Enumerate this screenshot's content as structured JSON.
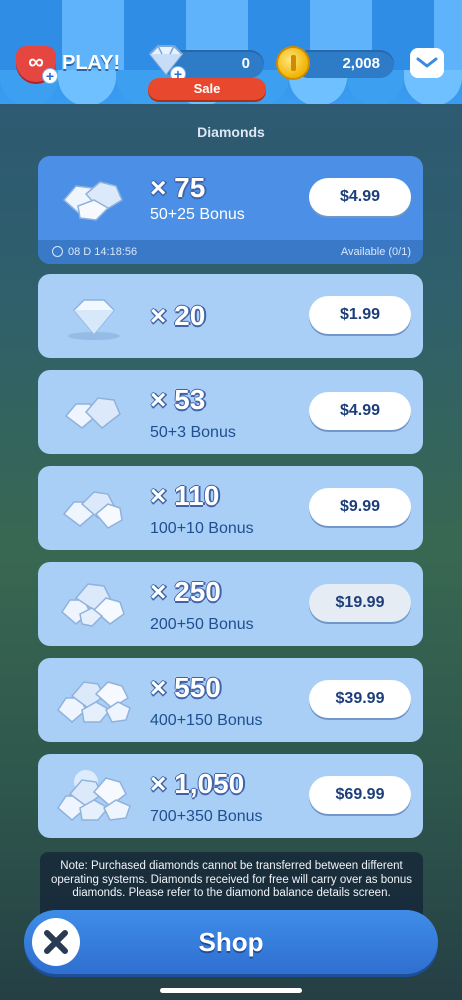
{
  "header": {
    "play_label": "PLAY!",
    "heart_symbol": "∞",
    "diamond_balance": "0",
    "coin_balance": "2,008",
    "sale_label": "Sale"
  },
  "section_title": "Diamonds",
  "featured_offer": {
    "quantity": "× 75",
    "bonus": "50+25 Bonus",
    "price": "$4.99",
    "timer": "08 D 14:18:56",
    "availability": "Available (0/1)"
  },
  "offers": [
    {
      "quantity": "× 20",
      "bonus": "",
      "price": "$1.99"
    },
    {
      "quantity": "× 53",
      "bonus": "50+3 Bonus",
      "price": "$4.99"
    },
    {
      "quantity": "× 110",
      "bonus": "100+10 Bonus",
      "price": "$9.99"
    },
    {
      "quantity": "× 250",
      "bonus": "200+50 Bonus",
      "price": "$19.99"
    },
    {
      "quantity": "× 550",
      "bonus": "400+150 Bonus",
      "price": "$39.99"
    },
    {
      "quantity": "× 1,050",
      "bonus": "700+350 Bonus",
      "price": "$69.99"
    }
  ],
  "note": "Note: Purchased diamonds cannot be transferred between different operating systems. Diamonds received for free will carry over as bonus diamonds. Please refer to the diamond balance details screen.",
  "footer": {
    "shop_label": "Shop"
  },
  "colors": {
    "card_bg": "#a9cff7",
    "featured_bg": "#4b90e6",
    "sale_red": "#e8492e",
    "shop_blue": "#2f6fd0"
  }
}
